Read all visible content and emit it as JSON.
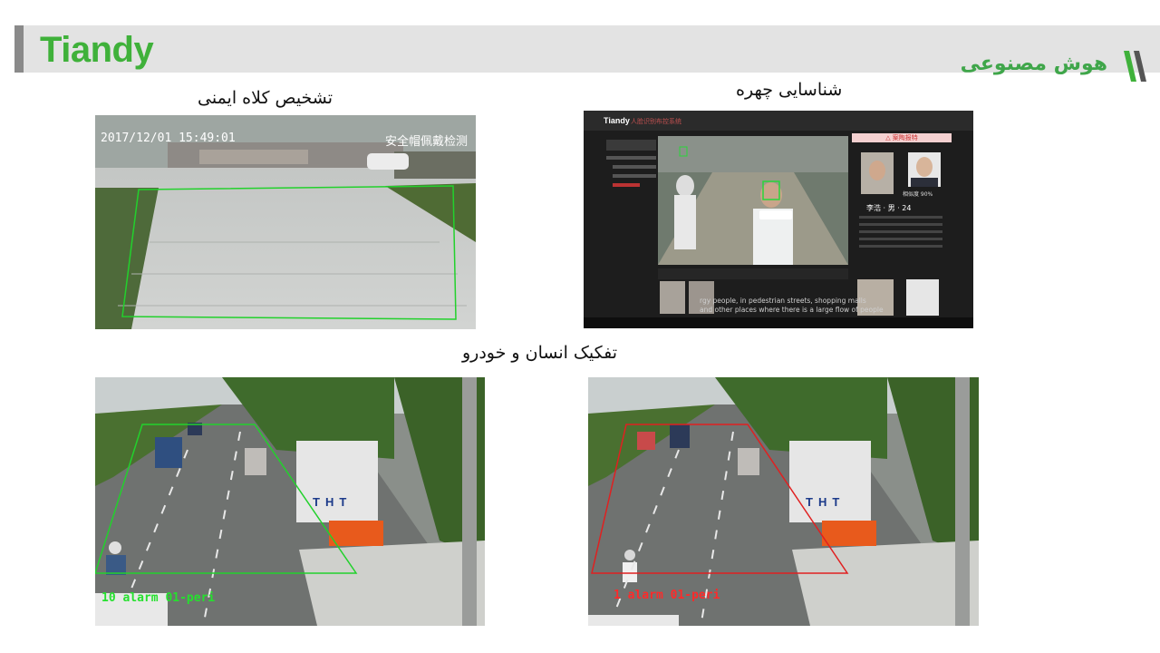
{
  "header": {
    "logo_text": "Tiandy",
    "title": "هوش مصنوعی",
    "brand_color": "#3fb13a"
  },
  "panels": {
    "helmet": {
      "caption": "تشخیص کلاه ایمنی",
      "timestamp": "2017/12/01 15:49:01",
      "overlay_text": "安全帽佩戴检测"
    },
    "face": {
      "caption": "شناسایی چهره",
      "app_logo": "Tiandy",
      "app_title": "人脸识别布控系统",
      "alert_label": "△ 案陶报特",
      "person_name": "李浩 · 男 · 24",
      "similarity": "相似度 90%",
      "subtitle_line1": "rgy people, in pedestrian streets, shopping malls",
      "subtitle_line2": "and other places where there is a large flow of people"
    },
    "separation_caption": "تفکیک انسان و خودرو",
    "vehicle_left": {
      "overlay_text": "10 alarm 01-peri",
      "sign_text": "THT"
    },
    "vehicle_right": {
      "overlay_text": "1 alarm 01-peri",
      "sign_text": "THT"
    }
  }
}
